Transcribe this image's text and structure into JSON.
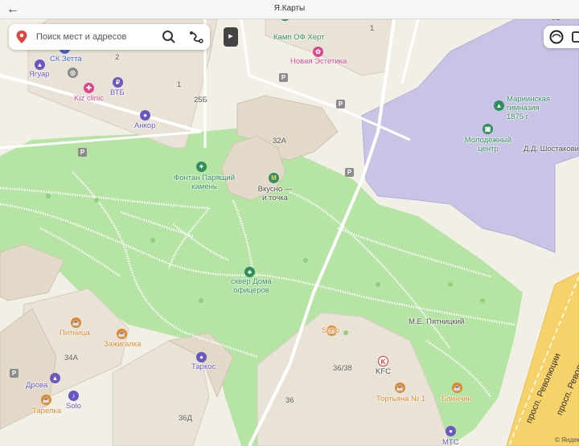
{
  "window": {
    "title": "Я.Карты"
  },
  "search": {
    "placeholder": "Поиск мест и адресов"
  },
  "map": {
    "buildings": {
      "b32": "32",
      "b1a": "1",
      "b2": "2",
      "b1b": "1",
      "b25b": "25Б",
      "b32a": "32А",
      "b34a": "34А",
      "b3638": "36/38",
      "b36": "36",
      "b36d": "36Д"
    },
    "pois": {
      "kamp_of_hert": "Камп ОФ Херт",
      "novaya_estetika": "Новая Эстетика",
      "sk_zetta": "СК Зетта",
      "yaguar": "Ягуар",
      "kiz_clinic": "Kiz clinic",
      "vtb": "ВТБ",
      "ancor": "Анкор",
      "fontan": "Фонтан Парящий камень",
      "vkusno": "Вкусно — и точка",
      "mariinskaya": "Мариинская гимназия 1875 г.",
      "molodezhny": "Молодёжный центр",
      "shostakovich": "Д.Д. Шостакович",
      "skver": "сквер Дома офицеров",
      "pyatnitsky": "М.Е. Пятницкий",
      "pitnitsa": "Питница",
      "zazhigalka": "Зажигалка",
      "soho": "Soho",
      "kfc": "KFC",
      "tarkos": "Таркос",
      "drova": "Дрова",
      "tarelka": "Тарелка",
      "solo": "Solo",
      "tortyana": "Тортьяна № 1",
      "blinchik": "Блинчик",
      "mts": "МТС"
    },
    "streets": {
      "revolution_a": "просп. Революции",
      "revolution_b": "просп. Революции"
    },
    "copyright": "© Яндекс"
  },
  "colors": {
    "park": "#b6e4a4",
    "building": "#e9e2d6",
    "building_beige": "#e3d9c9",
    "gymnasium": "#c9c4e6",
    "avenue": "#f6d26a",
    "path": "#ffffff",
    "poi_green": "#2f8f5b",
    "poi_pink": "#d9478a",
    "poi_orange": "#e0872a"
  }
}
